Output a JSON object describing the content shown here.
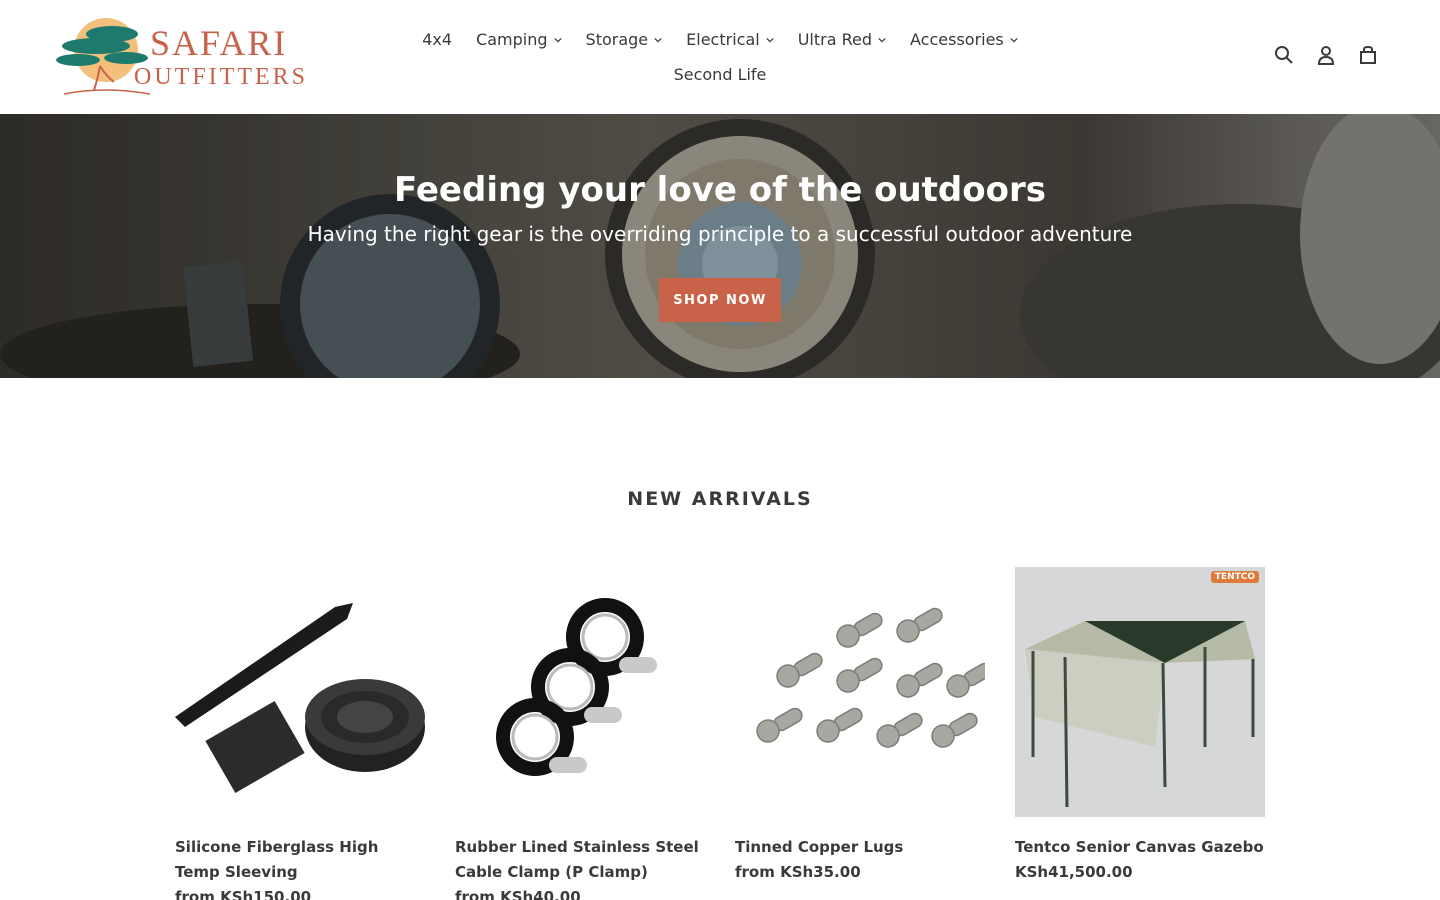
{
  "brand": {
    "line1": "SAFARI",
    "line2": "OUTFITTERS",
    "accent": "#c8634a",
    "tree_color": "#1f7a6e",
    "sun_color": "#f2c07a"
  },
  "nav": {
    "row1": [
      {
        "label": "4x4",
        "dropdown": false
      },
      {
        "label": "Camping",
        "dropdown": true
      },
      {
        "label": "Storage",
        "dropdown": true
      },
      {
        "label": "Electrical",
        "dropdown": true
      },
      {
        "label": "Ultra Red",
        "dropdown": true
      },
      {
        "label": "Accessories",
        "dropdown": true
      }
    ],
    "row2": [
      {
        "label": "Second Life",
        "dropdown": false
      }
    ]
  },
  "header_icons": [
    "search-icon",
    "account-icon",
    "cart-icon"
  ],
  "hero": {
    "title": "Feeding your love of the outdoors",
    "subtitle": "Having the right gear is the overriding principle to a successful outdoor adventure",
    "button": "SHOP NOW"
  },
  "section": {
    "title": "NEW ARRIVALS"
  },
  "products": [
    {
      "title": "Silicone Fiberglass High Temp Sleeving",
      "price": "from KSh150.00"
    },
    {
      "title": "Rubber Lined Stainless Steel Cable Clamp (P Clamp)",
      "price": "from KSh40.00"
    },
    {
      "title": "Tinned Copper Lugs",
      "price": "from KSh35.00"
    },
    {
      "title": "Tentco Senior Canvas Gazebo",
      "price": "KSh41,500.00",
      "badge": "TENTCO"
    }
  ]
}
